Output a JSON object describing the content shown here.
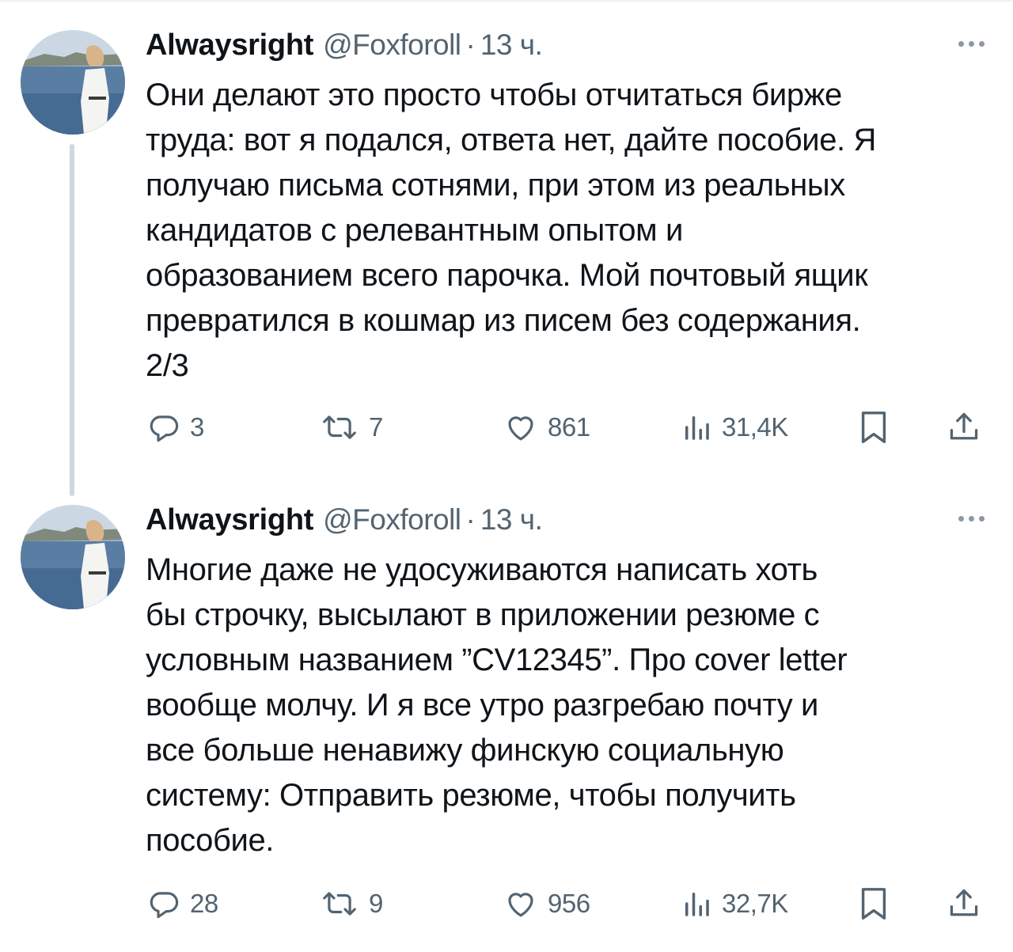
{
  "tweets": [
    {
      "name": "Alwaysright",
      "handle": "@Foxforoll",
      "separator": "·",
      "time": "13 ч.",
      "text": "Они делают это просто чтобы отчитаться бирже\nтруда: вот я подался, ответа нет, дайте пособие. Я\nполучаю письма сотнями, при этом из реальных\nкандидатов с релевантным опытом и\nобразованием всего парочка. Мой почтовый ящик\nпревратился в кошмар из писем без содержания.\n2/3",
      "replies": "3",
      "retweets": "7",
      "likes": "861",
      "views": "31,4K"
    },
    {
      "name": "Alwaysright",
      "handle": "@Foxforoll",
      "separator": "·",
      "time": "13 ч.",
      "text": "Многие даже не удосуживаются написать хоть\nбы строчку, высылают в приложении резюме с\nусловным названием ”CV12345”. Про cover letter\nвообще молчу. И я все утро разгребаю почту и\nвсе больше ненавижу финскую социальную\nсистему: Отправить резюме, чтобы получить\nпособие.",
      "replies": "28",
      "retweets": "9",
      "likes": "956",
      "views": "32,7K"
    }
  ],
  "icons": {
    "reply": "reply-icon",
    "retweet": "retweet-icon",
    "like": "like-icon",
    "views": "views-icon",
    "bookmark": "bookmark-icon",
    "share": "share-icon",
    "more": "more-icon"
  },
  "colors": {
    "text": "#0f1419",
    "secondary": "#536471",
    "thread_line": "#cfd9de"
  }
}
